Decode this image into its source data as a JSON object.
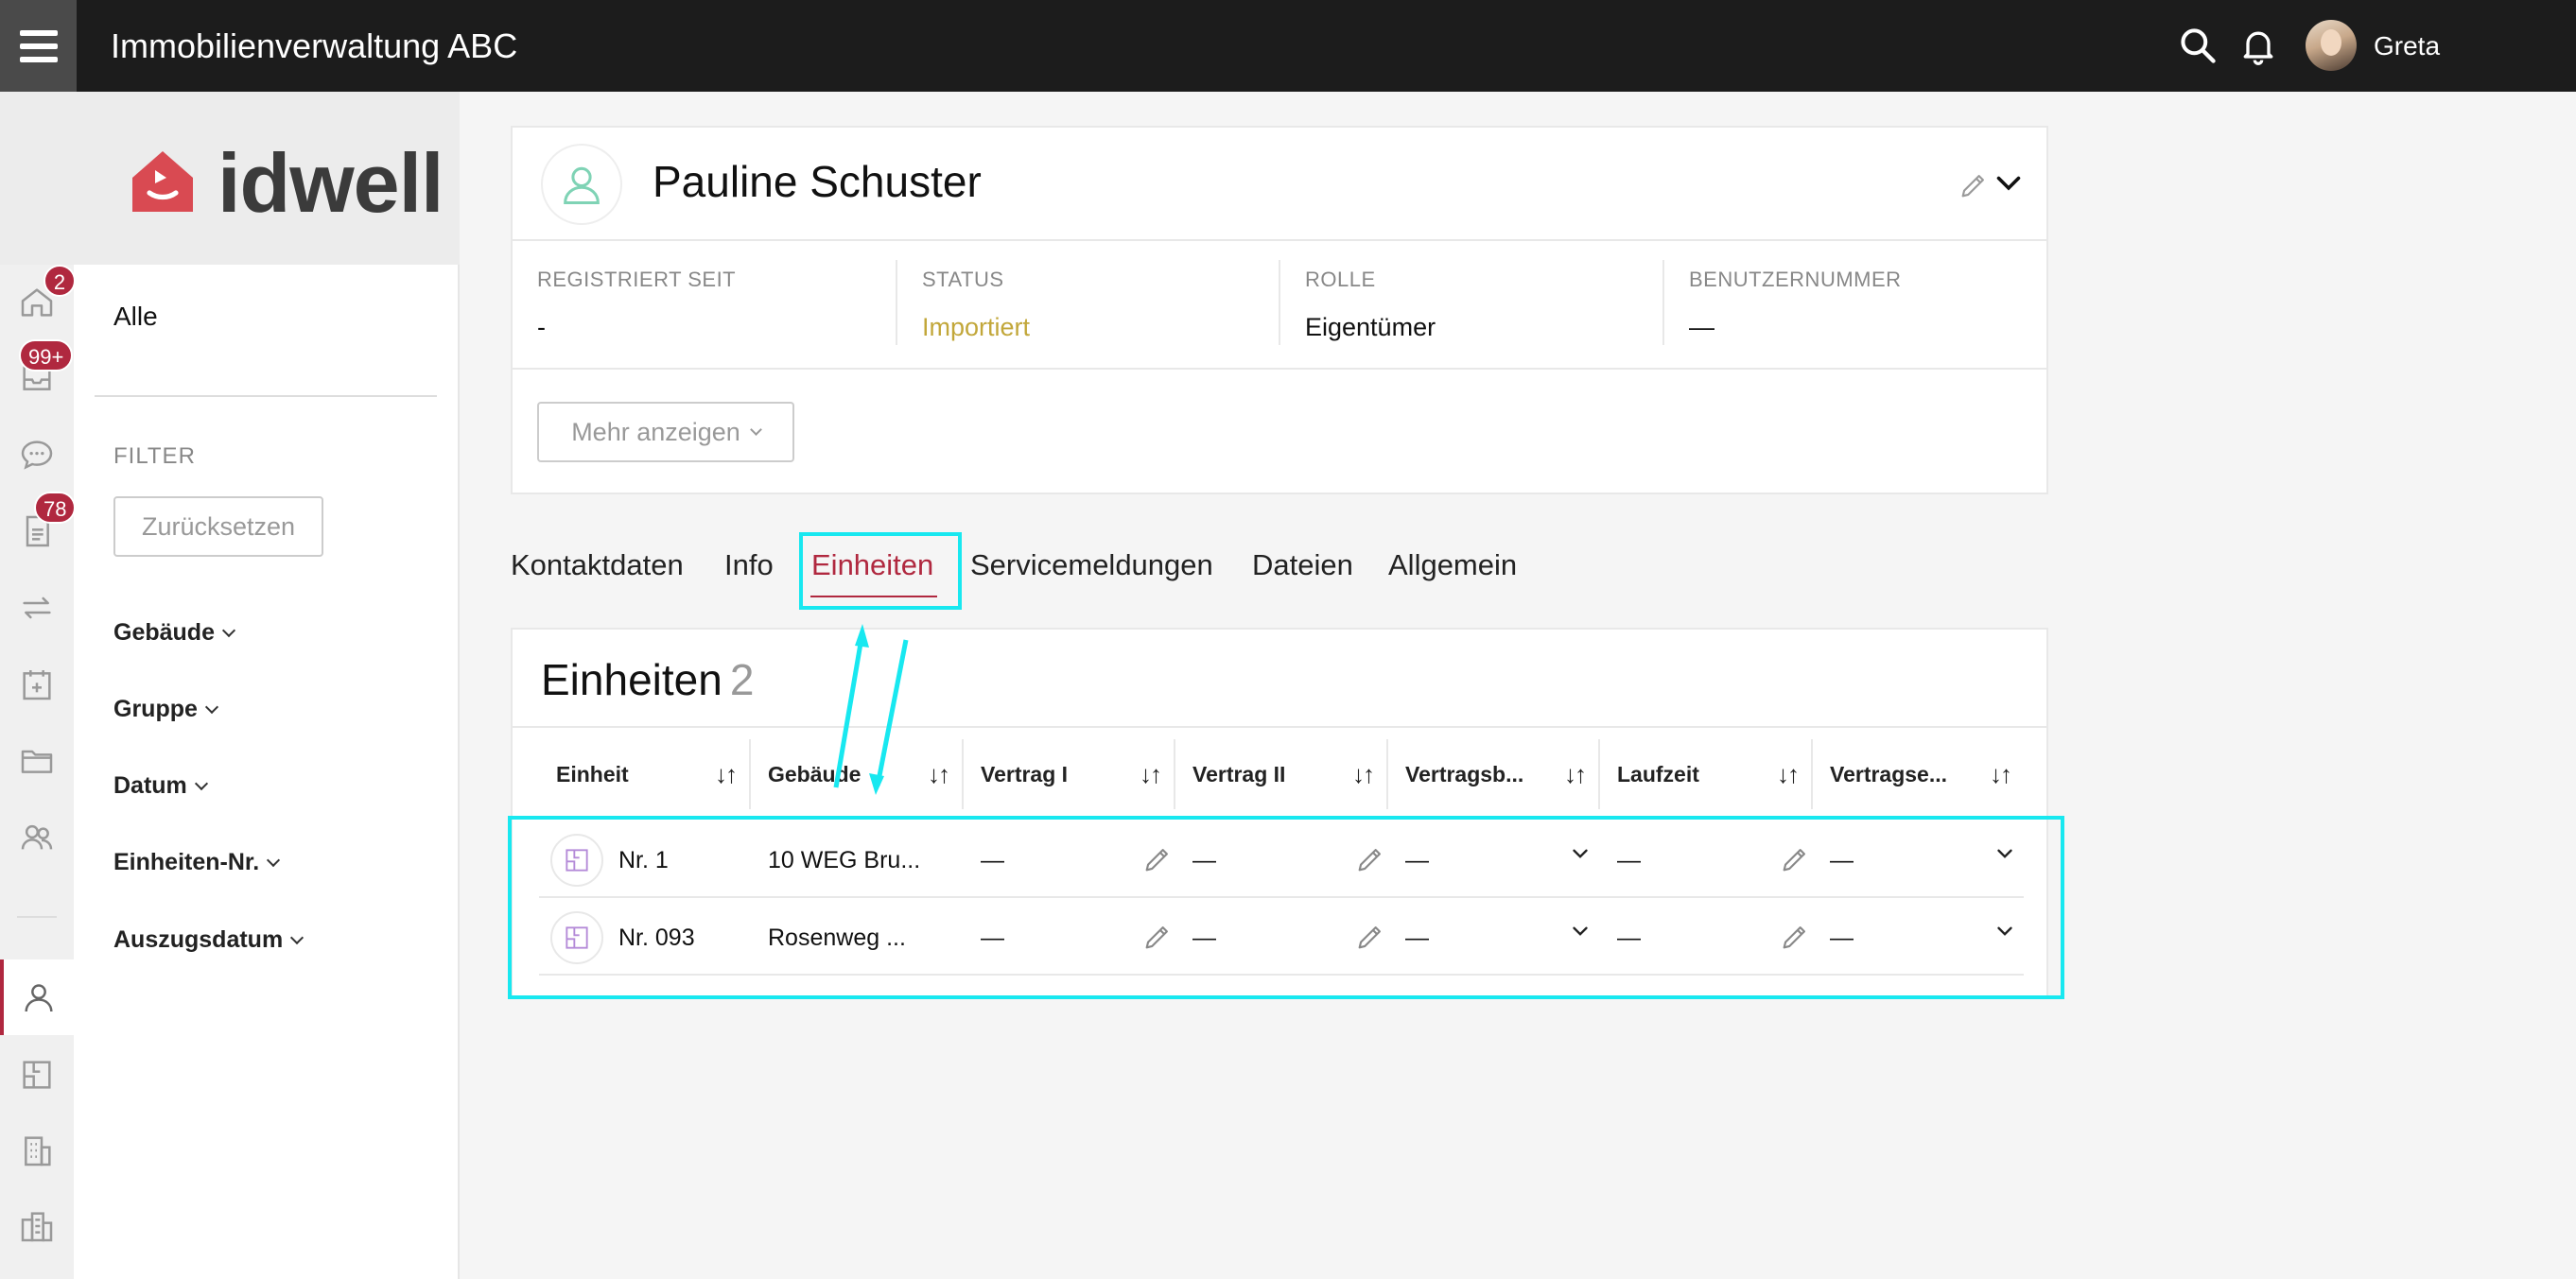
{
  "topbar": {
    "app_title": "Immobilienverwaltung ABC",
    "user_name": "Greta",
    "icons": [
      "menu-icon",
      "search-icon",
      "bell-icon"
    ]
  },
  "rail": {
    "badges": {
      "home": "2",
      "inbox": "99+",
      "documents": "78"
    },
    "items": [
      "home-icon",
      "inbox-icon",
      "chat-icon",
      "document-icon",
      "transfer-icon",
      "calendar-icon",
      "folder-icon",
      "contacts-icon",
      "person-icon",
      "floorplan-icon",
      "building-icon",
      "buildings-icon"
    ]
  },
  "logo": {
    "text": "idwell"
  },
  "filters": {
    "all": "Alle",
    "heading": "FILTER",
    "reset": "Zurücksetzen",
    "items": [
      "Gebäude",
      "Gruppe",
      "Datum",
      "Einheiten-Nr.",
      "Auszugsdatum"
    ]
  },
  "profile": {
    "name": "Pauline Schuster",
    "fields": [
      {
        "label": "REGISTRIERT SEIT",
        "value": "-"
      },
      {
        "label": "STATUS",
        "value": "Importiert"
      },
      {
        "label": "ROLLE",
        "value": "Eigentümer"
      },
      {
        "label": "BENUTZERNUMMER",
        "value": "—"
      }
    ],
    "more_button": "Mehr anzeigen"
  },
  "tabs": [
    "Kontaktdaten",
    "Info",
    "Einheiten",
    "Servicemeldungen",
    "Dateien",
    "Allgemein"
  ],
  "active_tab": "Einheiten",
  "units": {
    "title": "Einheiten",
    "count": "2",
    "columns": [
      "Einheit",
      "Gebäude",
      "Vertrag I",
      "Vertrag II",
      "Vertragsb...",
      "Laufzeit",
      "Vertragse..."
    ],
    "sort_glyph": "↓↑",
    "rows": [
      {
        "unit": "Nr. 1",
        "building": "10 WEG Bru...",
        "v1": "—",
        "v2": "—",
        "vb": "—",
        "lz": "—",
        "ve": "—"
      },
      {
        "unit": "Nr. 093",
        "building": "Rosenweg ...",
        "v1": "—",
        "v2": "—",
        "vb": "—",
        "lz": "—",
        "ve": "—"
      }
    ]
  },
  "colors": {
    "accent": "#b0283f",
    "status": "#c2a73a",
    "highlight": "#18e8f0",
    "topbar": "#1c1c1c"
  }
}
